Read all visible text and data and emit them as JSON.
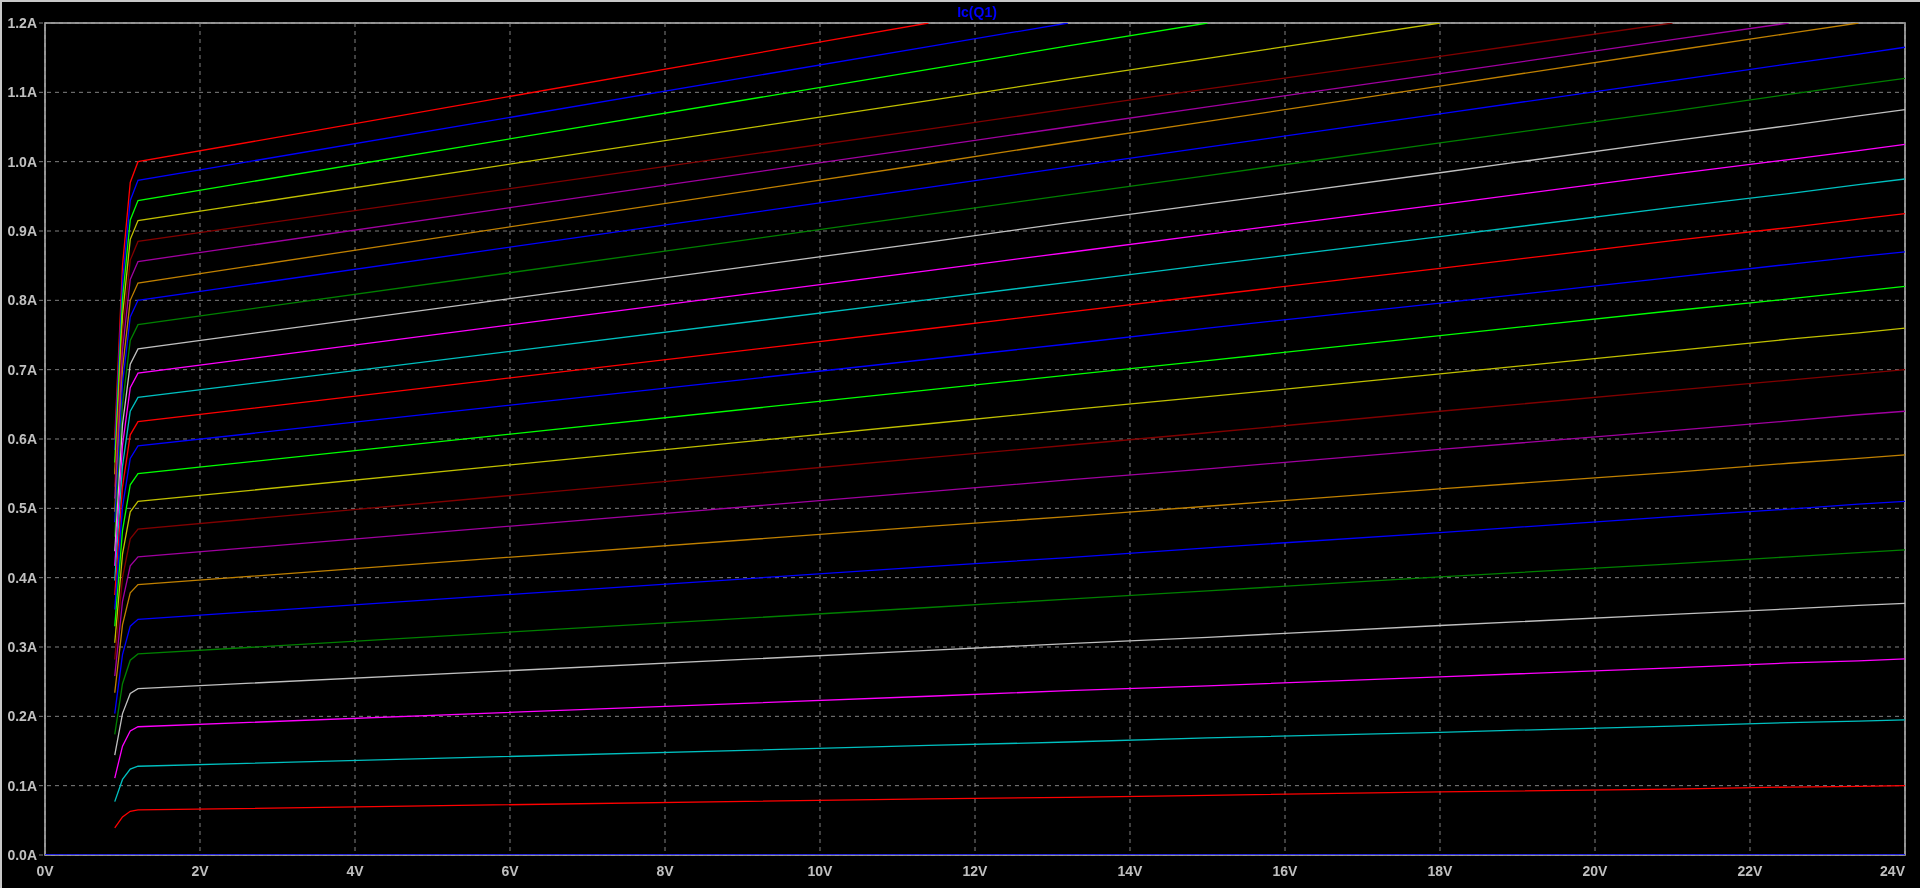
{
  "plot": {
    "chart_data": {
      "type": "line",
      "title": "Ic(Q1)",
      "grid": true,
      "xlim": [
        0,
        24
      ],
      "ylim": [
        0,
        1.2
      ],
      "xticks": [
        {
          "value": 0,
          "label": "0V"
        },
        {
          "value": 2,
          "label": "2V"
        },
        {
          "value": 4,
          "label": "4V"
        },
        {
          "value": 6,
          "label": "6V"
        },
        {
          "value": 8,
          "label": "8V"
        },
        {
          "value": 10,
          "label": "10V"
        },
        {
          "value": 12,
          "label": "12V"
        },
        {
          "value": 14,
          "label": "14V"
        },
        {
          "value": 16,
          "label": "16V"
        },
        {
          "value": 18,
          "label": "18V"
        },
        {
          "value": 20,
          "label": "20V"
        },
        {
          "value": 22,
          "label": "22V"
        },
        {
          "value": 24,
          "label": "24V"
        }
      ],
      "yticks": [
        {
          "value": 0,
          "label": "0.0A"
        },
        {
          "value": 0.1,
          "label": "0.1A"
        },
        {
          "value": 0.2,
          "label": "0.2A"
        },
        {
          "value": 0.3,
          "label": "0.3A"
        },
        {
          "value": 0.4,
          "label": "0.4A"
        },
        {
          "value": 0.5,
          "label": "0.5A"
        },
        {
          "value": 0.6,
          "label": "0.6A"
        },
        {
          "value": 0.7,
          "label": "0.7A"
        },
        {
          "value": 0.8,
          "label": "0.8A"
        },
        {
          "value": 0.9,
          "label": "0.9A"
        },
        {
          "value": 1.0,
          "label": "1.0A"
        },
        {
          "value": 1.1,
          "label": "1.1A"
        },
        {
          "value": 1.2,
          "label": "1.2A"
        }
      ],
      "x": [
        0,
        0.5,
        0.9,
        1.0,
        1.1,
        1.2,
        11.4,
        13.2,
        15,
        18,
        21,
        22.5,
        23.4,
        24
      ],
      "series": [
        {
          "color": "#0000ff",
          "values": [
            0,
            0,
            0,
            0,
            0,
            0,
            0,
            0,
            0,
            0,
            0,
            0,
            0,
            0
          ]
        },
        {
          "color": "#ff0000",
          "values": [
            null,
            null,
            0.039,
            0.055,
            0.063,
            0.065,
            0.081,
            0.083,
            0.086,
            0.091,
            0.095,
            0.098,
            0.099,
            0.1
          ]
        },
        {
          "color": "#00c0c0",
          "values": [
            null,
            null,
            0.077,
            0.109,
            0.124,
            0.128,
            0.158,
            0.163,
            0.169,
            0.177,
            0.186,
            0.191,
            0.193,
            0.195
          ]
        },
        {
          "color": "#ff00ff",
          "values": [
            null,
            null,
            0.111,
            0.157,
            0.179,
            0.185,
            0.229,
            0.237,
            0.244,
            0.257,
            0.27,
            0.277,
            0.28,
            0.283
          ]
        },
        {
          "color": "#c0c0c0",
          "values": [
            null,
            null,
            0.144,
            0.204,
            0.233,
            0.24,
            0.295,
            0.305,
            0.314,
            0.331,
            0.347,
            0.355,
            0.36,
            0.363
          ]
        },
        {
          "color": "#008000",
          "values": [
            null,
            null,
            0.174,
            0.247,
            0.281,
            0.29,
            0.357,
            0.369,
            0.381,
            0.401,
            0.42,
            0.43,
            0.436,
            0.44
          ]
        },
        {
          "color": "#0000ff",
          "values": [
            null,
            null,
            0.204,
            0.289,
            0.33,
            0.34,
            0.416,
            0.429,
            0.443,
            0.465,
            0.488,
            0.499,
            0.506,
            0.51
          ]
        },
        {
          "color": "#c08000",
          "values": [
            null,
            null,
            0.234,
            0.332,
            0.378,
            0.39,
            0.474,
            0.488,
            0.503,
            0.528,
            0.552,
            0.565,
            0.572,
            0.577
          ]
        },
        {
          "color": "#a000a0",
          "values": [
            null,
            null,
            0.258,
            0.366,
            0.417,
            0.43,
            0.524,
            0.541,
            0.557,
            0.585,
            0.612,
            0.626,
            0.635,
            0.64
          ]
        },
        {
          "color": "#800000",
          "values": [
            null,
            null,
            0.282,
            0.4,
            0.456,
            0.47,
            0.573,
            0.591,
            0.609,
            0.64,
            0.67,
            0.685,
            0.694,
            0.7
          ]
        },
        {
          "color": "#c0c000",
          "values": [
            null,
            null,
            0.306,
            0.434,
            0.495,
            0.51,
            0.622,
            0.642,
            0.661,
            0.694,
            0.727,
            0.744,
            0.753,
            0.76
          ]
        },
        {
          "color": "#00ff00",
          "values": [
            null,
            null,
            0.33,
            0.468,
            0.534,
            0.55,
            0.671,
            0.692,
            0.713,
            0.749,
            0.785,
            0.802,
            0.813,
            0.82
          ]
        },
        {
          "color": "#0000ff",
          "values": [
            null,
            null,
            0.354,
            0.502,
            0.572,
            0.59,
            0.715,
            0.737,
            0.76,
            0.796,
            0.833,
            0.852,
            0.863,
            0.87
          ]
        },
        {
          "color": "#ff0000",
          "values": [
            null,
            null,
            0.375,
            0.531,
            0.606,
            0.625,
            0.759,
            0.783,
            0.807,
            0.846,
            0.886,
            0.905,
            0.917,
            0.925
          ]
        },
        {
          "color": "#00c0c0",
          "values": [
            null,
            null,
            0.396,
            0.561,
            0.64,
            0.66,
            0.801,
            0.826,
            0.851,
            0.892,
            0.934,
            0.954,
            0.967,
            0.975
          ]
        },
        {
          "color": "#ff00ff",
          "values": [
            null,
            null,
            0.417,
            0.591,
            0.674,
            0.695,
            0.843,
            0.869,
            0.895,
            0.938,
            0.982,
            1.003,
            1.016,
            1.025
          ]
        },
        {
          "color": "#c0c0c0",
          "values": [
            null,
            null,
            0.438,
            0.621,
            0.708,
            0.73,
            0.884,
            0.912,
            0.939,
            0.984,
            1.03,
            1.052,
            1.066,
            1.075
          ]
        },
        {
          "color": "#008000",
          "values": [
            null,
            null,
            0.459,
            0.65,
            0.742,
            0.765,
            0.924,
            0.952,
            0.98,
            1.027,
            1.073,
            1.097,
            1.111,
            1.12
          ]
        },
        {
          "color": "#0000ff",
          "values": [
            null,
            null,
            0.48,
            0.68,
            0.776,
            0.8,
            0.963,
            0.992,
            1.021,
            1.069,
            1.117,
            1.141,
            1.155,
            1.165
          ]
        },
        {
          "color": "#c08000",
          "values": [
            null,
            null,
            0.495,
            0.701,
            0.8,
            0.825,
            0.997,
            1.028,
            1.058,
            1.109,
            1.16,
            1.185,
            1.2,
            null
          ]
        },
        {
          "color": "#a000a0",
          "values": [
            null,
            null,
            0.514,
            0.728,
            0.83,
            0.856,
            1.021,
            1.05,
            1.079,
            1.127,
            1.176,
            1.2,
            null,
            null
          ]
        },
        {
          "color": "#800000",
          "values": [
            null,
            null,
            0.531,
            0.752,
            0.858,
            0.885,
            1.047,
            1.076,
            1.105,
            1.152,
            1.2,
            null,
            null,
            null
          ]
        },
        {
          "color": "#c0c000",
          "values": [
            null,
            null,
            0.549,
            0.778,
            0.888,
            0.915,
            1.088,
            1.119,
            1.149,
            1.2,
            null,
            null,
            null,
            null
          ]
        },
        {
          "color": "#00ff00",
          "values": [
            null,
            null,
            0.566,
            0.802,
            0.916,
            0.944,
            1.133,
            1.167,
            1.2,
            null,
            null,
            null,
            null,
            null
          ]
        },
        {
          "color": "#0000ff",
          "values": [
            null,
            null,
            0.584,
            0.827,
            0.944,
            0.973,
            1.166,
            1.2,
            null,
            null,
            null,
            null,
            null,
            null
          ]
        },
        {
          "color": "#ff0000",
          "values": [
            null,
            null,
            0.6,
            0.85,
            0.97,
            1.0,
            1.2,
            null,
            null,
            null,
            null,
            null,
            null,
            null
          ]
        }
      ]
    }
  }
}
